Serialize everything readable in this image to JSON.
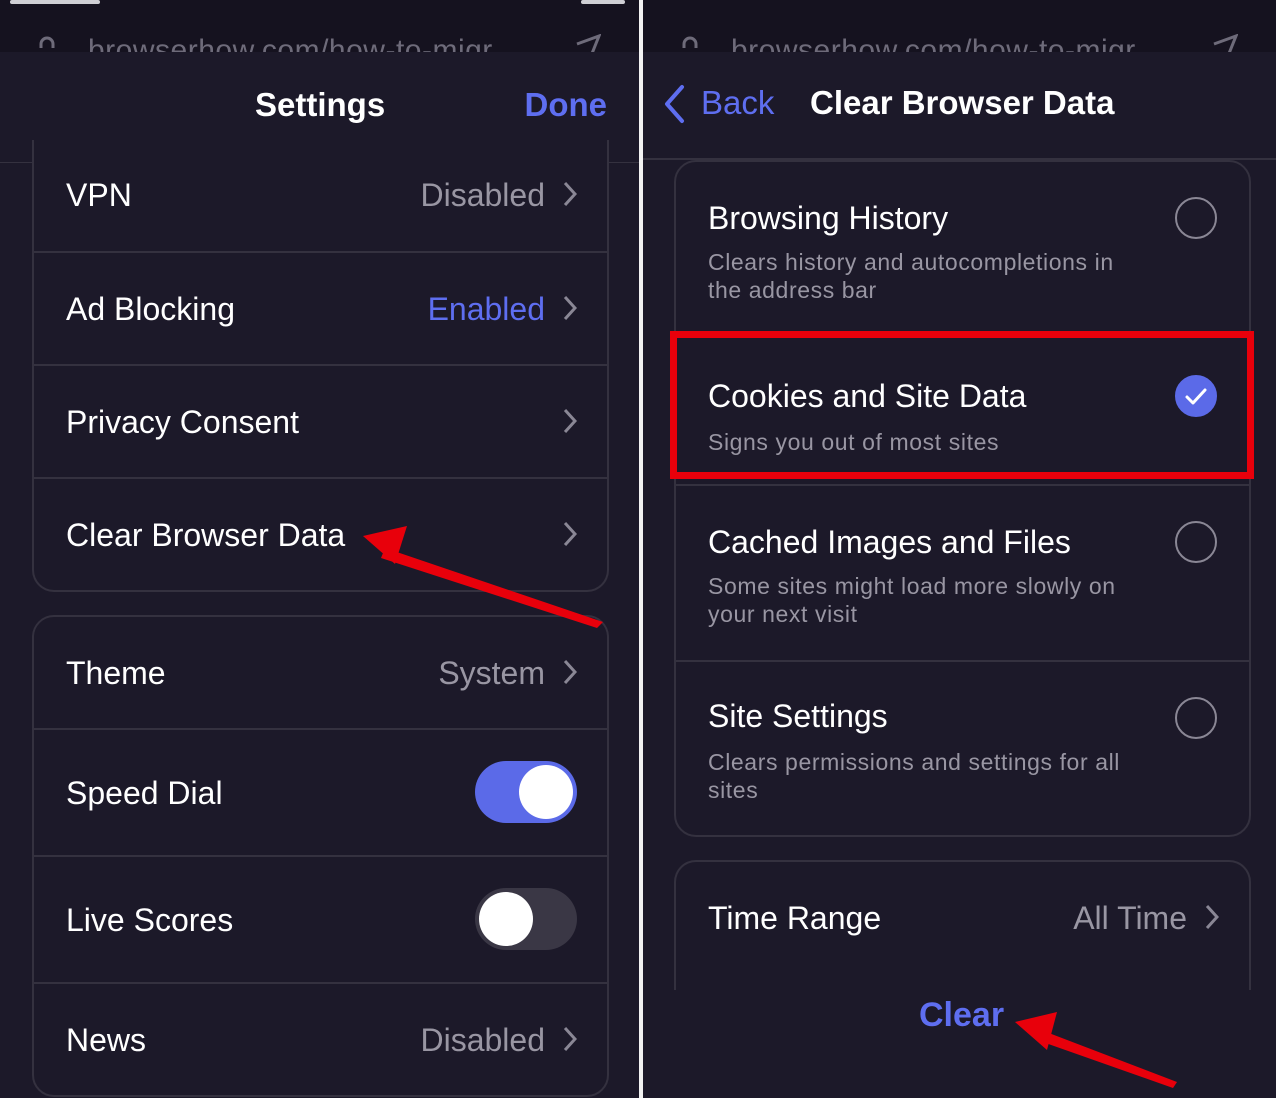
{
  "address_bar": {
    "url": "browserhow.com/how-to-migr..."
  },
  "settings": {
    "title": "Settings",
    "done_label": "Done",
    "group1": [
      {
        "label": "VPN",
        "value": "Disabled"
      },
      {
        "label": "Ad Blocking",
        "value": "Enabled"
      },
      {
        "label": "Privacy Consent",
        "value": ""
      },
      {
        "label": "Clear Browser Data",
        "value": ""
      }
    ],
    "group2": [
      {
        "label": "Theme",
        "value": "System"
      },
      {
        "label": "Speed Dial",
        "toggle": "on"
      },
      {
        "label": "Live Scores",
        "toggle": "off"
      },
      {
        "label": "News",
        "value": "Disabled"
      }
    ]
  },
  "clear_data": {
    "back_label": "Back",
    "title": "Clear Browser Data",
    "options": [
      {
        "title": "Browsing History",
        "desc": "Clears history and autocompletions in the address bar",
        "checked": false
      },
      {
        "title": "Cookies and Site Data",
        "desc": "Signs you out of most sites",
        "checked": true
      },
      {
        "title": "Cached Images and Files",
        "desc": "Some sites might load more slowly on your next visit",
        "checked": false
      },
      {
        "title": "Site Settings",
        "desc": "Clears permissions and settings for all sites",
        "checked": false
      }
    ],
    "time_range": {
      "label": "Time Range",
      "value": "All Time"
    },
    "clear_label": "Clear"
  },
  "colors": {
    "background": "#1c1929",
    "accent": "#5e6ef0",
    "highlight": "#e8000b",
    "secondary_text": "#9996a3"
  }
}
